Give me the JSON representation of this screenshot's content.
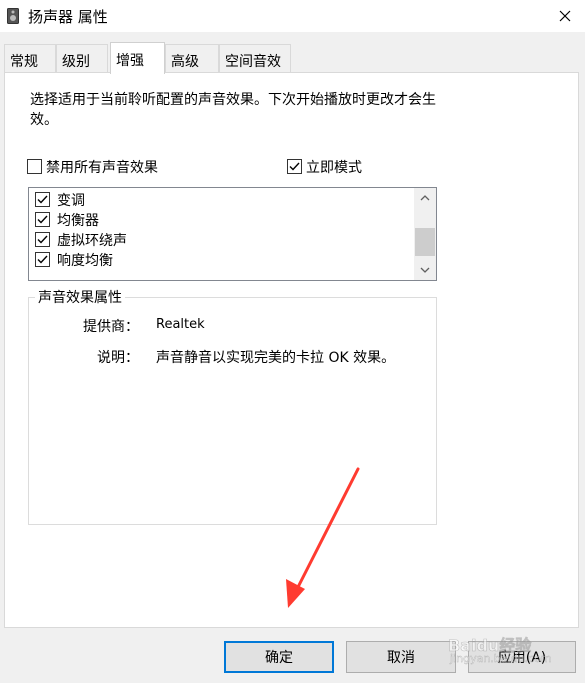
{
  "window": {
    "title": "扬声器 属性",
    "close_icon": "close-icon"
  },
  "tabs": [
    {
      "label": "常规"
    },
    {
      "label": "级别"
    },
    {
      "label": "增强"
    },
    {
      "label": "高级"
    },
    {
      "label": "空间音效"
    }
  ],
  "active_tab": "增强",
  "enhance": {
    "description": "选择适用于当前聆听配置的声音效果。下次开始播放时更改才会生效。",
    "disable_all": {
      "label": "禁用所有声音效果",
      "checked": false
    },
    "immediate_mode": {
      "label": "立即模式",
      "checked": true
    },
    "effects": [
      {
        "label": "变调",
        "checked": true
      },
      {
        "label": "均衡器",
        "checked": true
      },
      {
        "label": "虚拟环绕声",
        "checked": true
      },
      {
        "label": "响度均衡",
        "checked": true
      }
    ],
    "properties": {
      "group_title": "声音效果属性",
      "provider_key": "提供商：",
      "provider_value": "Realtek",
      "desc_key": "说明：",
      "desc_value": "声音静音以实现完美的卡拉 OK 效果。"
    }
  },
  "buttons": {
    "ok": "确定",
    "cancel": "取消",
    "apply": "应用(A)"
  },
  "watermark": {
    "text_top": "Baidu经验",
    "text_bottom": "jingyan.baidu.com"
  },
  "colors": {
    "accent": "#0078d7",
    "annotation_arrow": "#ff3b30"
  }
}
